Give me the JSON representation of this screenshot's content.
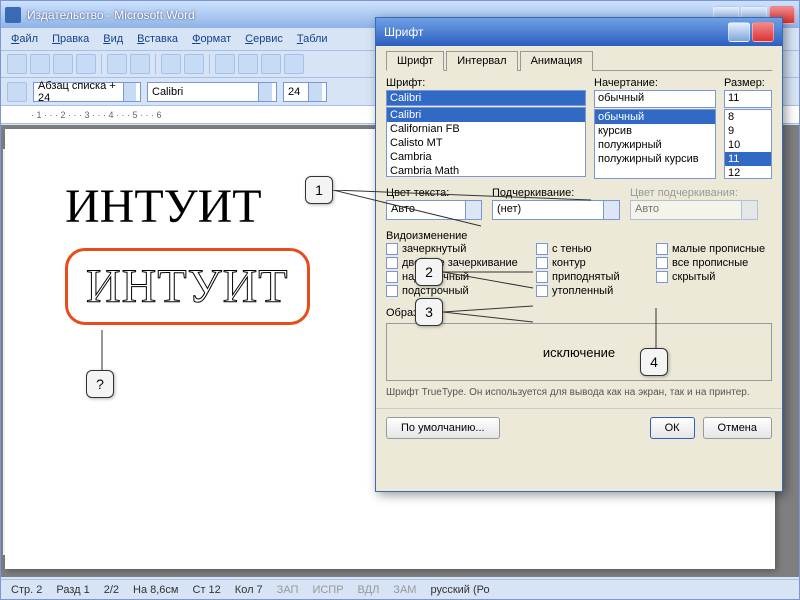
{
  "window": {
    "title": "Издательство - Microsoft Word"
  },
  "menu": [
    "Файл",
    "Правка",
    "Вид",
    "Вставка",
    "Формат",
    "Сервис",
    "Табли"
  ],
  "format_bar": {
    "style": "Абзац списка + 24",
    "font": "Calibri",
    "size": "24"
  },
  "doc": {
    "text1": "ИНТУИТ",
    "text2": "ИНТУИТ"
  },
  "dialog": {
    "title": "Шрифт",
    "tabs": [
      "Шрифт",
      "Интервал",
      "Анимация"
    ],
    "font_label": "Шрифт:",
    "font_value": "Calibri",
    "font_list": [
      "Calibri",
      "Californian FB",
      "Calisto MT",
      "Cambria",
      "Cambria Math"
    ],
    "style_label": "Начертание:",
    "style_value": "обычный",
    "style_list": [
      "обычный",
      "курсив",
      "полужирный",
      "полужирный курсив"
    ],
    "size_label": "Размер:",
    "size_value": "11",
    "size_list": [
      "8",
      "9",
      "10",
      "11",
      "12"
    ],
    "color_label": "Цвет текста:",
    "color_value": "Авто",
    "underline_label": "Подчеркивание:",
    "underline_value": "(нет)",
    "underline_color_label": "Цвет подчеркивания:",
    "underline_color_value": "Авто",
    "effects_label": "Видоизменение",
    "effects_col1": [
      "зачеркнутый",
      "двойное зачеркивание",
      "надстрочный",
      "подстрочный"
    ],
    "effects_col2": [
      "с тенью",
      "контур",
      "приподнятый",
      "утопленный"
    ],
    "effects_col3": [
      "малые прописные",
      "все прописные",
      "скрытый"
    ],
    "preview_label": "Образец",
    "preview_text": "исключение",
    "hint": "Шрифт TrueType. Он используется для вывода как на экран, так и на принтер.",
    "btn_default": "По умолчанию...",
    "btn_ok": "ОК",
    "btn_cancel": "Отмена"
  },
  "callouts": {
    "c1": "1",
    "c2": "2",
    "c3": "3",
    "c4": "4",
    "cq": "?"
  },
  "status": {
    "page": "Стр. 2",
    "section": "Разд 1",
    "pages": "2/2",
    "at": "На 8,6см",
    "line": "Ст 12",
    "col": "Кол 7",
    "rec": "ЗАП",
    "trk": "ИСПР",
    "ext": "ВДЛ",
    "ovr": "ЗАМ",
    "lang": "русский (Ро"
  }
}
